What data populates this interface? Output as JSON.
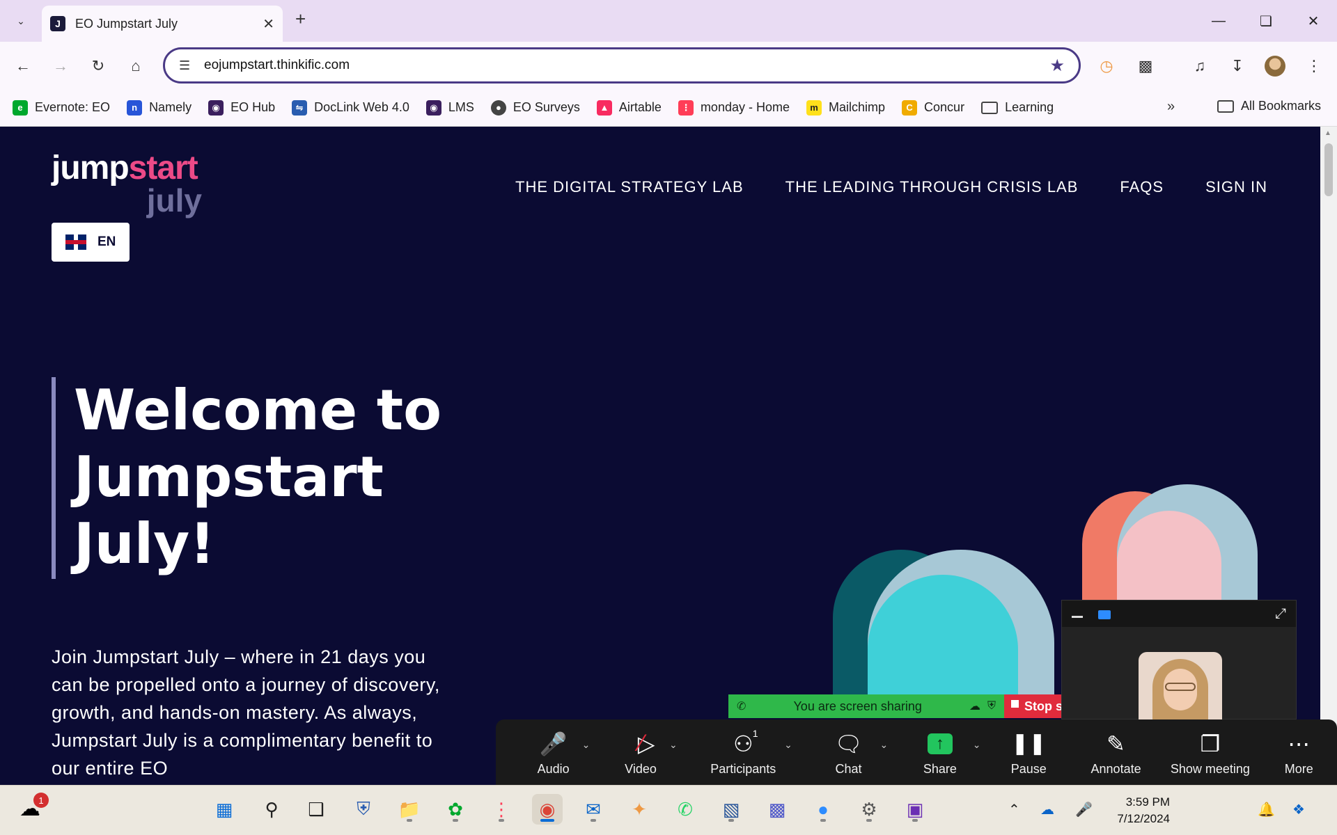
{
  "browser": {
    "tab_title": "EO Jumpstart July",
    "tab_favicon": "J",
    "url": "eojumpstart.thinkific.com",
    "bookmarks": [
      {
        "label": "Evernote: EO",
        "color": "#00a82d"
      },
      {
        "label": "Namely",
        "color": "#2855d8"
      },
      {
        "label": "EO Hub",
        "color": "#3b1f5e"
      },
      {
        "label": "DocLink Web 4.0",
        "color": "#2a5db0"
      },
      {
        "label": "LMS",
        "color": "#3b1f5e"
      },
      {
        "label": "EO Surveys",
        "color": "#444444"
      },
      {
        "label": "Airtable",
        "color": "#f82b60"
      },
      {
        "label": "monday - Home",
        "color": "#ff3d57"
      },
      {
        "label": "Mailchimp",
        "color": "#ffe01b"
      },
      {
        "label": "Concur",
        "color": "#f0ab00"
      },
      {
        "label": "Learning",
        "color": "folder"
      }
    ],
    "all_bookmarks": "All Bookmarks"
  },
  "site": {
    "logo_line1_a": "jump",
    "logo_line1_b": "start",
    "logo_line2": "july",
    "lang": "EN",
    "nav": [
      "THE DIGITAL STRATEGY LAB",
      "THE LEADING THROUGH CRISIS LAB",
      "FAQS",
      "SIGN IN"
    ],
    "hero_title": "Welcome to Jumpstart July!",
    "hero_text": "Join Jumpstart July – where in 21 days you can be propelled onto a journey of discovery, growth, and hands-on mastery. As always, Jumpstart July is a complimentary benefit to our entire EO"
  },
  "zoom": {
    "sharing_msg": "You are screen sharing",
    "stop_share": "Stop share",
    "participants_count": "1",
    "controls": [
      "Audio",
      "Video",
      "Participants",
      "Chat",
      "Share",
      "Pause",
      "Annotate",
      "Show meeting",
      "More"
    ]
  },
  "taskbar": {
    "notification_count": "1",
    "time": "3:59 PM",
    "date": "7/12/2024"
  }
}
